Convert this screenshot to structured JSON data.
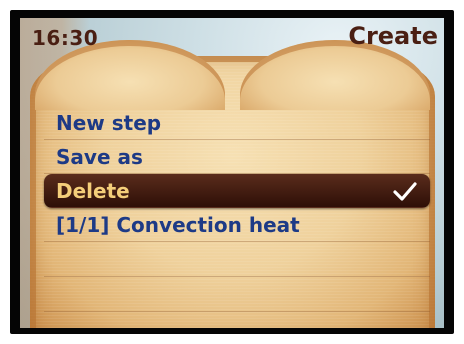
{
  "status": {
    "time": "16:30"
  },
  "header": {
    "title": "Create"
  },
  "menu": {
    "items": [
      {
        "label": "New step",
        "selected": false
      },
      {
        "label": "Save as",
        "selected": false
      },
      {
        "label": "Delete",
        "selected": true
      },
      {
        "label": "[1/1] Convection heat",
        "selected": false
      }
    ],
    "selected_icon": "check-icon"
  },
  "colors": {
    "text_dark": "#4a1f13",
    "menu_text": "#1d3a86",
    "selection_bg": "#3a160b",
    "selection_text": "#f4ce7a"
  }
}
